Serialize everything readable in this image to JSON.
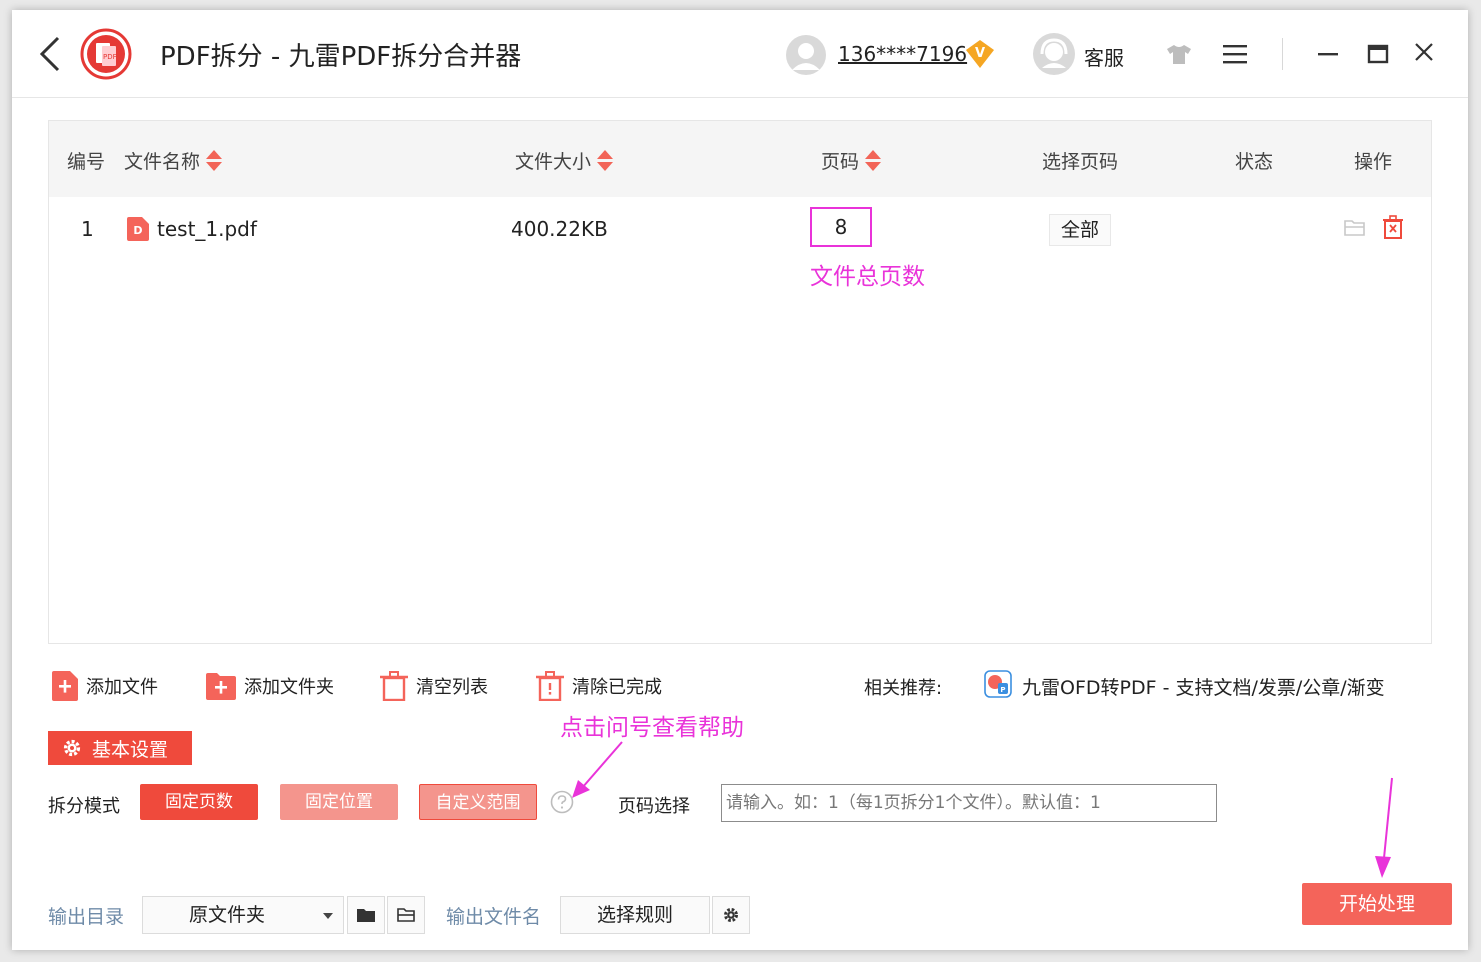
{
  "titlebar": {
    "title": "PDF拆分 - 九雷PDF拆分合并器",
    "user": "136****7196",
    "vip_badge": "V",
    "support": "客服"
  },
  "table": {
    "columns": {
      "index": "编号",
      "filename": "文件名称",
      "size": "文件大小",
      "pages": "页码",
      "select_pages": "选择页码",
      "status": "状态",
      "actions": "操作"
    },
    "rows": [
      {
        "index": "1",
        "filename": "test_1.pdf",
        "size": "400.22KB",
        "pages": "8",
        "select_pages": "全部",
        "status": ""
      }
    ]
  },
  "annotations": {
    "pages_note": "文件总页数",
    "help_note": "点击问号查看帮助"
  },
  "toolbar": {
    "add_file": "添加文件",
    "add_folder": "添加文件夹",
    "clear_list": "清空列表",
    "clear_done": "清除已完成",
    "recommend_label": "相关推荐:",
    "recommend_text": "九雷OFD转PDF - 支持文档/发票/公章/渐变"
  },
  "settings": {
    "tab_label": "基本设置",
    "split_mode_label": "拆分模式",
    "modes": [
      "固定页数",
      "固定位置",
      "自定义范围"
    ],
    "page_select_label": "页码选择",
    "page_select_placeholder": "请输入。如：1（每1页拆分1个文件）。默认值：1"
  },
  "output": {
    "dir_label": "输出目录",
    "dir_value": "原文件夹",
    "filename_label": "输出文件名",
    "rule_button": "选择规则",
    "start_button": "开始处理"
  },
  "colors": {
    "accent": "#ef4a3c",
    "accent_light": "#f4958d",
    "annotation": "#e933d9",
    "label_blue": "#6f8ba8"
  }
}
